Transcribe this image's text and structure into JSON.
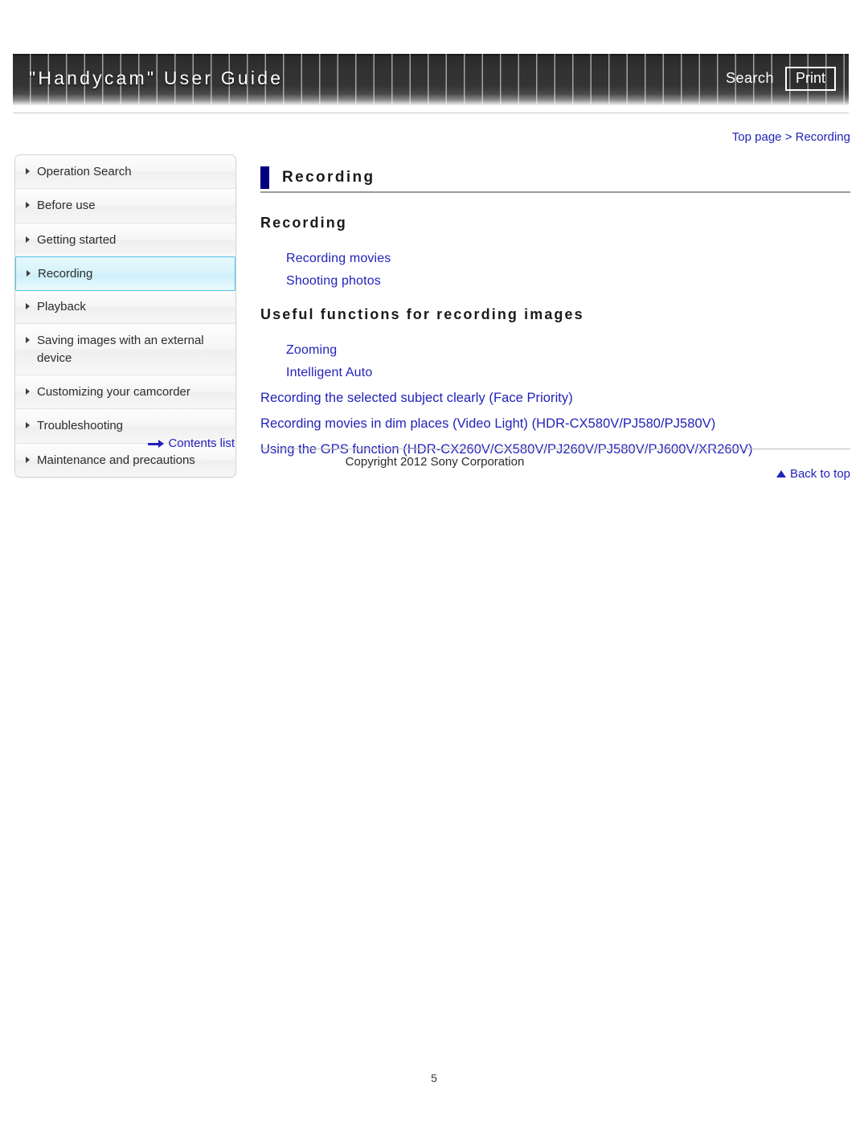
{
  "header": {
    "title": "\"Handycam\" User Guide",
    "search_label": "Search",
    "print_label": "Print"
  },
  "breadcrumb": {
    "top": "Top page",
    "separator": ">",
    "current": "Recording",
    "full": "Top page > Recording"
  },
  "sidebar": {
    "items": [
      {
        "label": "Operation Search",
        "active": false
      },
      {
        "label": "Before use",
        "active": false
      },
      {
        "label": "Getting started",
        "active": false
      },
      {
        "label": "Recording",
        "active": true
      },
      {
        "label": "Playback",
        "active": false
      },
      {
        "label": "Saving images with an external device",
        "active": false
      },
      {
        "label": "Customizing your camcorder",
        "active": false
      },
      {
        "label": "Troubleshooting",
        "active": false
      },
      {
        "label": "Maintenance and precautions",
        "active": false
      }
    ],
    "contents_list_label": "Contents list"
  },
  "main": {
    "page_title": "Recording",
    "sections": [
      {
        "heading": "Recording",
        "links": [
          "Recording movies",
          "Shooting photos"
        ]
      },
      {
        "heading": "Useful functions for recording images",
        "links": [
          "Zooming",
          "Intelligent Auto"
        ],
        "wide_links": [
          "Recording the selected subject clearly (Face Priority)",
          "Recording movies in dim places (Video Light) (HDR-CX580V/PJ580/PJ580V)",
          "Using the GPS function (HDR-CX260V/CX580V/PJ260V/PJ580V/PJ600V/XR260V)"
        ]
      }
    ],
    "back_to_top_label": "Back to top",
    "copyright": "Copyright 2012 Sony Corporation"
  },
  "footer": {
    "page_number": "5"
  },
  "colors": {
    "link": "#2222bb",
    "title_marker": "#000080",
    "active_nav_border": "#4ec3e8",
    "active_nav_fill": "#d8f3fb",
    "header_dark": "#313131"
  }
}
